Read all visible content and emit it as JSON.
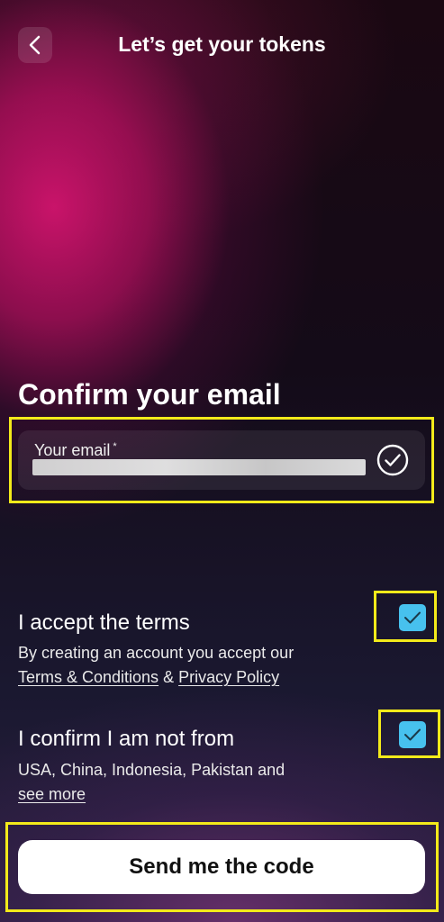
{
  "header": {
    "back_icon": "chevron-left-icon",
    "title": "Let’s get your tokens"
  },
  "form": {
    "title": "Confirm your email",
    "email": {
      "label": "Your email",
      "required_mark": "*",
      "value": "",
      "status_icon": "check-circle-icon"
    },
    "terms": {
      "title": "I accept the terms",
      "desc_prefix": "By creating an account you accept our ",
      "terms_link": "Terms & Conditions",
      "joiner": " & ",
      "privacy_link": "Privacy Policy",
      "checked": true
    },
    "residency": {
      "title": "I confirm I am not from",
      "desc": "USA, China, Indonesia, Pakistan and",
      "more_link": "see more",
      "checked": true
    }
  },
  "cta": {
    "label": "Send me the code"
  },
  "colors": {
    "accent": "#47c1ee",
    "highlight": "#f3ea1a",
    "primary_bg": "#ffffff"
  }
}
